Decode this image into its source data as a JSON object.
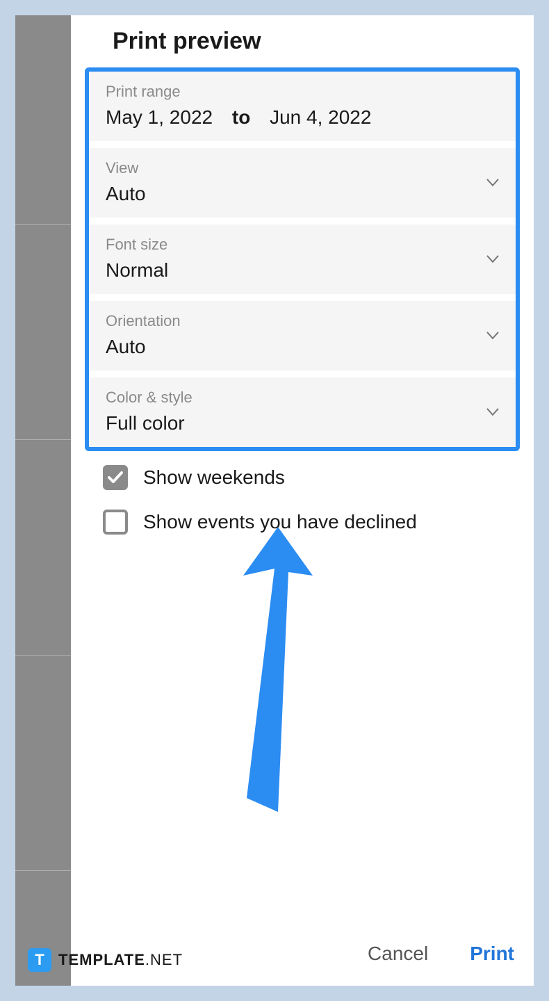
{
  "title": "Print preview",
  "range": {
    "label": "Print range",
    "start": "May 1, 2022",
    "to": "to",
    "end": "Jun 4, 2022"
  },
  "view": {
    "label": "View",
    "value": "Auto"
  },
  "fontSize": {
    "label": "Font size",
    "value": "Normal"
  },
  "orientation": {
    "label": "Orientation",
    "value": "Auto"
  },
  "colorStyle": {
    "label": "Color & style",
    "value": "Full color"
  },
  "checks": {
    "weekends": {
      "label": "Show weekends",
      "checked": true
    },
    "declined": {
      "label": "Show events you have declined",
      "checked": false
    }
  },
  "buttons": {
    "cancel": "Cancel",
    "print": "Print"
  },
  "watermark": {
    "badge": "T",
    "strong": "TEMPLATE",
    "rest": ".NET"
  }
}
